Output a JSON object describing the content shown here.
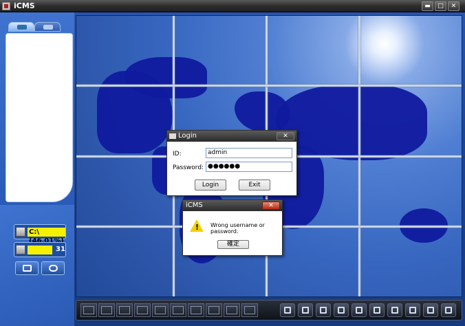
{
  "window": {
    "title": "iCMS"
  },
  "window_controls": {
    "minimize": "▬",
    "maximize": "□",
    "close": "✕"
  },
  "sidebar": {
    "disk_status": "C:\\ (46.01%)",
    "channel_count": "31"
  },
  "login_dialog": {
    "title": "Login",
    "close": "✕",
    "id_label": "ID:",
    "id_value": "admin",
    "password_label": "Password:",
    "password_value": "●●●●●●",
    "login_button": "Login",
    "exit_button": "Exit"
  },
  "error_dialog": {
    "title": "iCMS",
    "close": "✕",
    "message": "Wrong username or password.",
    "ok_button": "確定"
  },
  "colors": {
    "accent": "#2a56b0",
    "disk_bar": "#f4f000",
    "close_red": "#b52a14"
  },
  "icons": [
    "app-icon",
    "camera-tab-icon",
    "map-tab-icon",
    "disk-icon",
    "channel-icon",
    "fullscreen-icon",
    "snapshot-icon",
    "warning-icon"
  ]
}
